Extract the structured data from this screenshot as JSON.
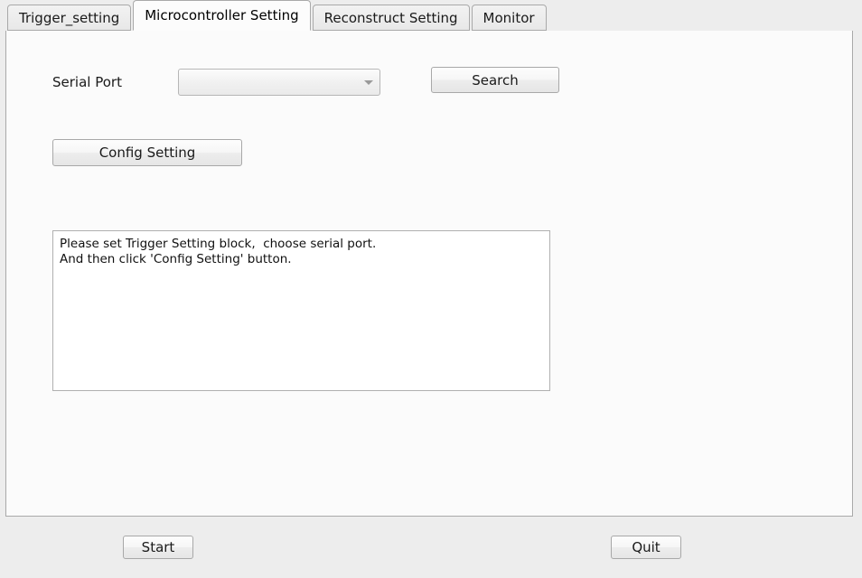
{
  "window": {
    "background_color": "#ededed",
    "panel_background_color": "#fbfbfb"
  },
  "tabs": [
    {
      "label": "Trigger_setting",
      "active": false
    },
    {
      "label": "Microcontroller Setting",
      "active": true
    },
    {
      "label": "Reconstruct Setting",
      "active": false
    },
    {
      "label": "Monitor",
      "active": false
    }
  ],
  "form": {
    "serial_port_label": "Serial Port",
    "serial_port_value": "",
    "serial_port_placeholder": "",
    "search_button": "Search",
    "config_button": "Config Setting"
  },
  "log": {
    "text": "Please set Trigger Setting block,  choose serial port.\nAnd then click 'Config Setting' button."
  },
  "footer": {
    "start_button": "Start",
    "quit_button": "Quit"
  }
}
